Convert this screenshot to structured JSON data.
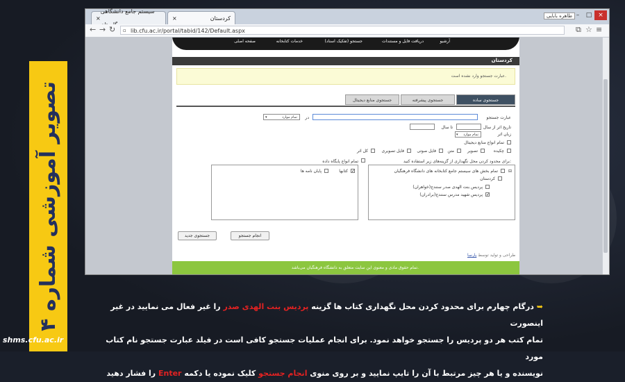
{
  "slide": {
    "banner_text": "تصویر آموزشی شماره ۴",
    "site_url": "shms.cfu.ac.ir",
    "caption": {
      "bullet": "➥",
      "line1_a": "درگام چهارم برای محدود کردن محل نگهداری کتاب ها گزینه ",
      "line1_hl": "پردیس بنت الهدی صدر",
      "line1_b": " را غیر فعال می نمایید در غیر اینصورت",
      "line2": "تمام کتب هر دو پردیس را جستجو خواهد نمود. برای انجام عملیات جستجو کافی است در فیلد عبارت جستجو نام کتاب مورد",
      "line3_a": "نویسنده و یا هر چیز مرتبط با آن را تایپ نمایید و بر روی منوی ",
      "line3_hl": "انجام جستجو",
      "line3_b": " کلیک نموده یا دکمه ",
      "line3_key": "Enter",
      "line3_c": " را فشار دهید"
    }
  },
  "browser": {
    "tabs": [
      {
        "label": "سیستم جامع دانشگاهی گلستان"
      },
      {
        "label": "کردستان"
      }
    ],
    "profile": "طاهره بابایی",
    "url": "lib.cfu.ac.ir/portal/tabid/142/Default.aspx"
  },
  "portal": {
    "nav": [
      "صفحه اصلی",
      "خدمات کتابخانه",
      "جستجو (تفکیک اسناد)",
      "دریافت فایل و مستندات",
      "آرشیو"
    ],
    "section_title": "کردستان",
    "message": "عبارت جستجو وارد نشده است.",
    "search_tabs": [
      "جستجوی ساده",
      "جستجوی پیشرفته",
      "جستجوی منابع دیجیتال"
    ],
    "labels": {
      "search_phrase": "عبارت جستجو",
      "in": "در",
      "all_fields": "تمام موارد",
      "year_from": "تاریخ اثر از سال",
      "year_to": "تا سال",
      "language": "زبان اثر",
      "all_languages": "تمام موارد",
      "all_digital": "تمام انواع منابع دیجیتال",
      "restrict_location": "برای محدود کردن محل نگهداری از گزینه‌های زیر استفاده کنید:",
      "all_db_types": "تمام انواع پایگاه داده"
    },
    "media_types": [
      "چکیده",
      "تصویر",
      "متن",
      "فایل صوتی",
      "فایل تصویری",
      "کل اثر"
    ],
    "tree": {
      "root": "تمام بخش های سیستم جامع کتابخانه های دانشگاه فرهنگیان",
      "province": "کردستان",
      "campus1": "پردیس بنت الهدی صدر سنندج(خواهران)",
      "campus2": "پردیس شهید مدرس سنندج(برادران)"
    },
    "db_types": [
      "کتابها",
      "پایان نامه ها"
    ],
    "buttons": {
      "search": "انجام جستجو",
      "new_search": "جستجوی جدید"
    },
    "design_credit_prefix": "طراحی و تولید توسط",
    "design_credit_link": "پارسا",
    "footer": "تمام حقوق مادی و معنوی این سایت متعلق به دانشگاه فرهنگیان می‌باشد."
  }
}
